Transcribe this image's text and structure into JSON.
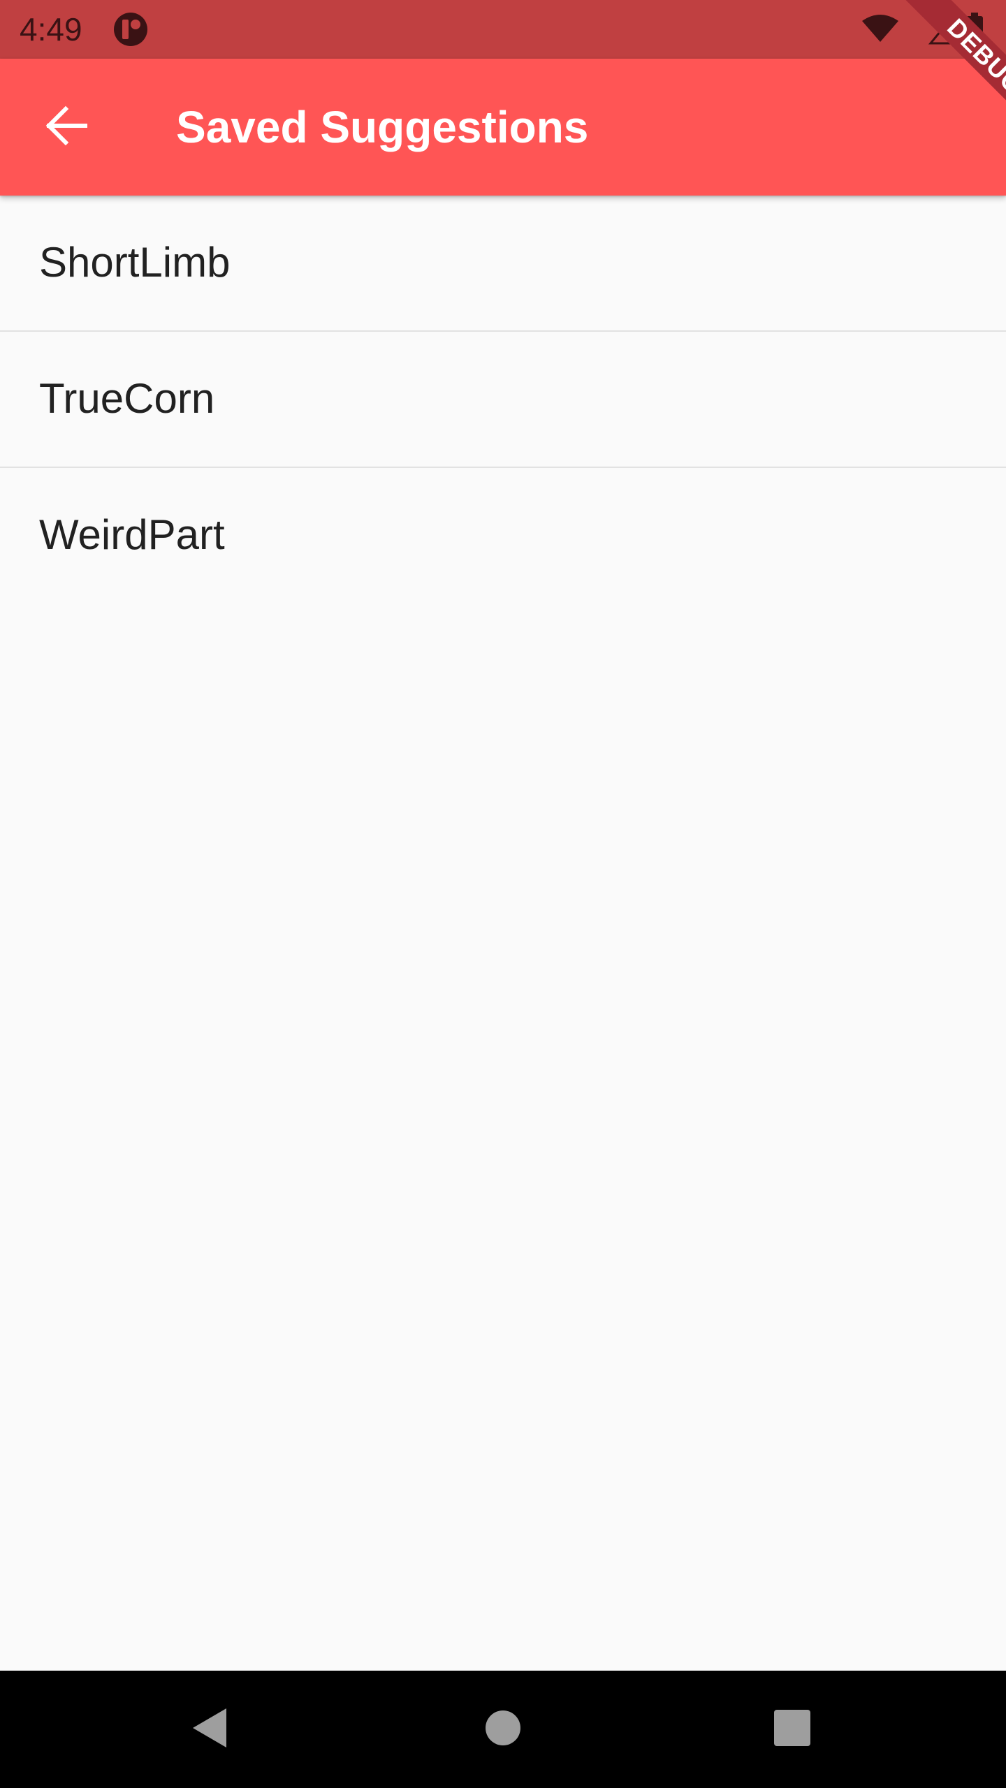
{
  "status_bar": {
    "time": "4:49",
    "app_icon": "app-notification-icon",
    "icons": [
      "wifi-icon",
      "cellular-signal-icon",
      "battery-icon"
    ],
    "background": "#c04041"
  },
  "debug_banner": {
    "label": "DEBUG",
    "color": "#a52b34"
  },
  "app_bar": {
    "title": "Saved Suggestions",
    "back_icon": "arrow-back-icon",
    "background": "#ff5555"
  },
  "saved_list": {
    "items": [
      {
        "label": "ShortLimb"
      },
      {
        "label": "TrueCorn"
      },
      {
        "label": "WeirdPart"
      }
    ]
  },
  "nav_bar": {
    "buttons": [
      "back-triangle-icon",
      "home-circle-icon",
      "recents-square-icon"
    ]
  }
}
